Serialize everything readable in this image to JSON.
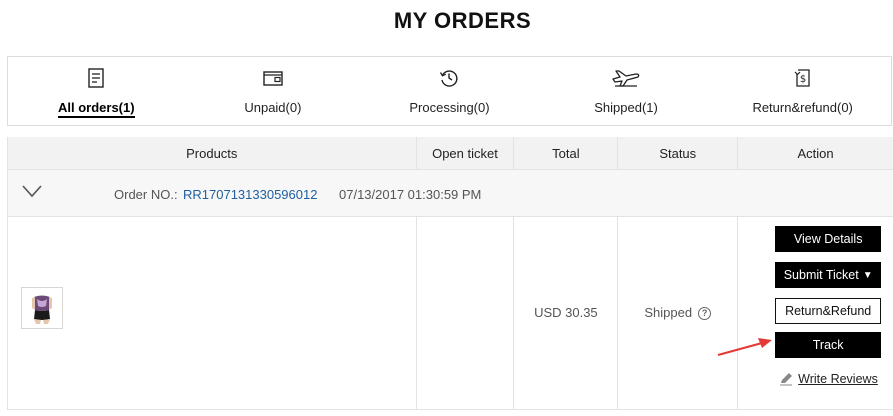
{
  "page": {
    "title": "MY ORDERS"
  },
  "tabs": [
    {
      "label": "All orders(1)",
      "icon": "document-list-icon",
      "active": true
    },
    {
      "label": "Unpaid(0)",
      "icon": "wallet-icon",
      "active": false
    },
    {
      "label": "Processing(0)",
      "icon": "history-clock-icon",
      "active": false
    },
    {
      "label": "Shipped(1)",
      "icon": "airplane-icon",
      "active": false
    },
    {
      "label": "Return&refund(0)",
      "icon": "refund-dollar-icon",
      "active": false
    }
  ],
  "table": {
    "headers": [
      "Products",
      "Open ticket",
      "Total",
      "Status",
      "Action"
    ]
  },
  "order": {
    "label": "Order NO.:",
    "number": "RR1707131330596012",
    "date": "07/13/2017 01:30:59 PM",
    "total": "USD 30.35",
    "status": "Shipped",
    "help_symbol": "?"
  },
  "actions": {
    "view_details": "View Details",
    "submit_ticket": "Submit Ticket",
    "submit_ticket_caret": "▼",
    "return_refund": "Return&Refund",
    "track": "Track",
    "write_reviews": "Write Reviews"
  },
  "colors": {
    "link": "#1f5fa0",
    "annotation_arrow": "#e53935",
    "button": "#000000"
  }
}
